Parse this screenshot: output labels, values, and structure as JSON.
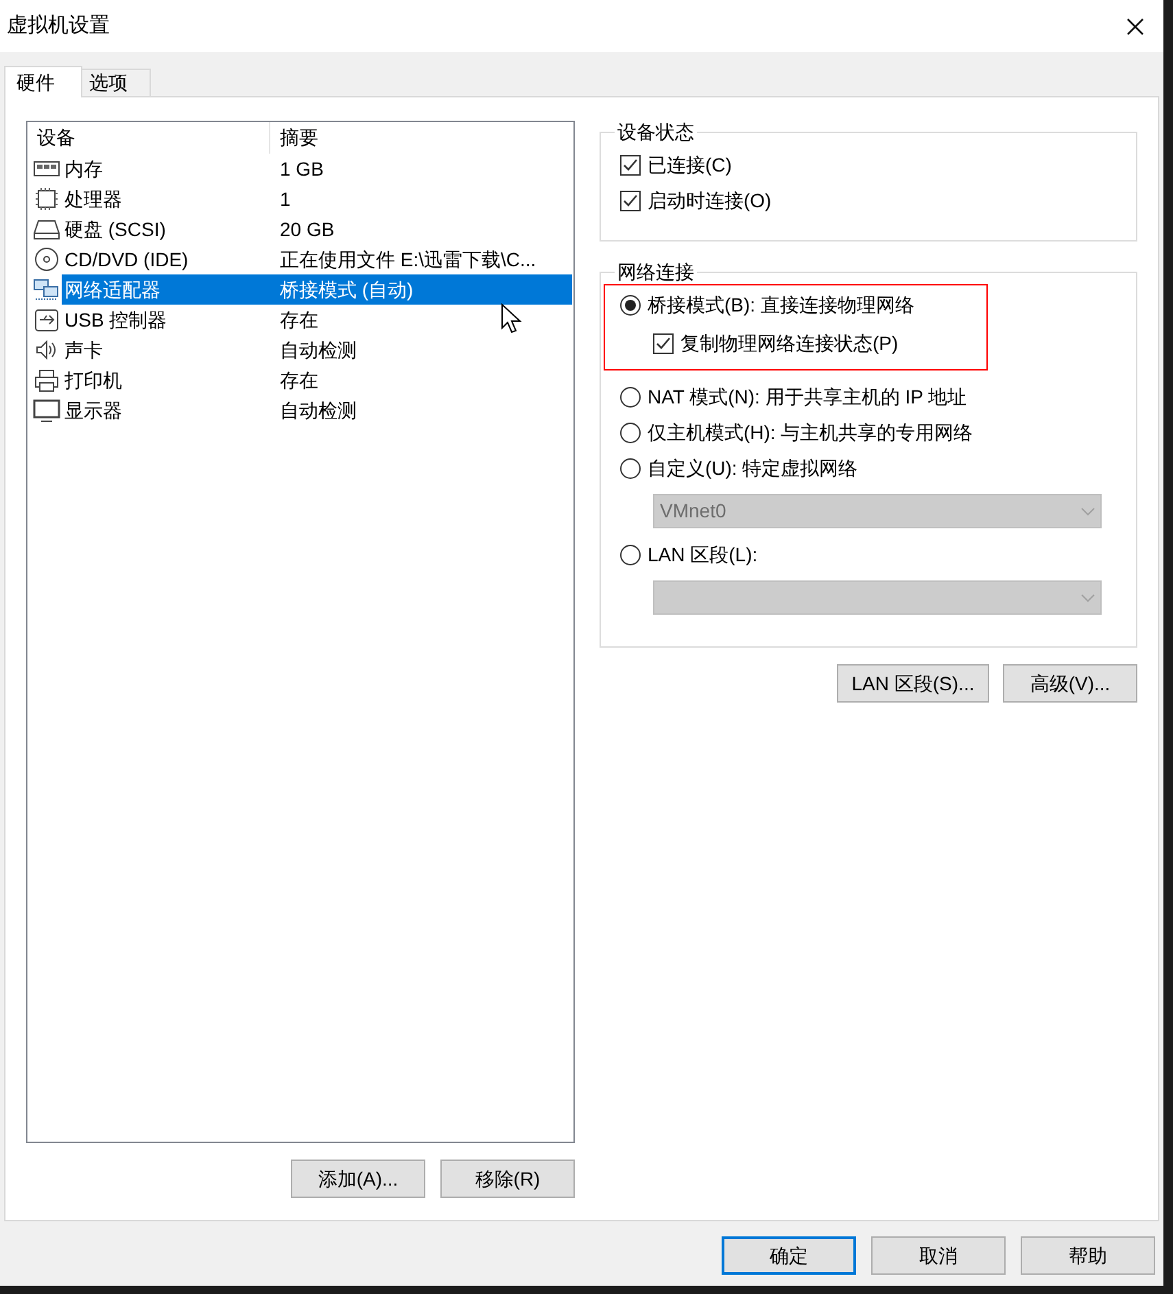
{
  "window": {
    "title": "虚拟机设置"
  },
  "tabs": [
    {
      "label": "硬件",
      "selected": true
    },
    {
      "label": "选项",
      "selected": false
    }
  ],
  "device_list": {
    "columns": [
      "设备",
      "摘要"
    ],
    "rows": [
      {
        "kind": "memory",
        "device": "内存",
        "summary": "1 GB",
        "selected": false
      },
      {
        "kind": "cpu",
        "device": "处理器",
        "summary": "1",
        "selected": false
      },
      {
        "kind": "disk",
        "device": "硬盘 (SCSI)",
        "summary": "20 GB",
        "selected": false
      },
      {
        "kind": "cdrom",
        "device": "CD/DVD (IDE)",
        "summary": "正在使用文件 E:\\迅雷下载\\C...",
        "selected": false
      },
      {
        "kind": "network",
        "device": "网络适配器",
        "summary": "桥接模式 (自动)",
        "selected": true
      },
      {
        "kind": "usb",
        "device": "USB 控制器",
        "summary": "存在",
        "selected": false
      },
      {
        "kind": "sound",
        "device": "声卡",
        "summary": "自动检测",
        "selected": false
      },
      {
        "kind": "printer",
        "device": "打印机",
        "summary": "存在",
        "selected": false
      },
      {
        "kind": "display",
        "device": "显示器",
        "summary": "自动检测",
        "selected": false
      }
    ]
  },
  "list_buttons": [
    "添加(A)...",
    "移除(R)"
  ],
  "device_status": {
    "title": "设备状态",
    "options": [
      {
        "label": "已连接(C)",
        "checked": true
      },
      {
        "label": "启动时连接(O)",
        "checked": true
      }
    ]
  },
  "network_connection": {
    "title": "网络连接",
    "items": [
      {
        "kind": "radio",
        "label": "桥接模式(B): 直接连接物理网络",
        "selected": true
      },
      {
        "kind": "checkbox",
        "label": "复制物理网络连接状态(P)",
        "checked": true
      },
      {
        "kind": "radio",
        "label": "NAT 模式(N): 用于共享主机的 IP 地址",
        "selected": false
      },
      {
        "kind": "radio",
        "label": "仅主机模式(H): 与主机共享的专用网络",
        "selected": false
      },
      {
        "kind": "radio",
        "label": "自定义(U): 特定虚拟网络",
        "selected": false
      },
      {
        "kind": "dropdown",
        "value": "VMnet0",
        "disabled": true
      },
      {
        "kind": "radio",
        "label": "LAN 区段(L):",
        "selected": false
      },
      {
        "kind": "dropdown",
        "disabled": true
      }
    ]
  },
  "network_buttons": [
    "LAN 区段(S)...",
    "高级(V)..."
  ],
  "dialog_buttons": [
    {
      "label": "确定",
      "default": true
    },
    {
      "label": "取消",
      "default": false
    },
    {
      "label": "帮助",
      "default": false
    }
  ]
}
